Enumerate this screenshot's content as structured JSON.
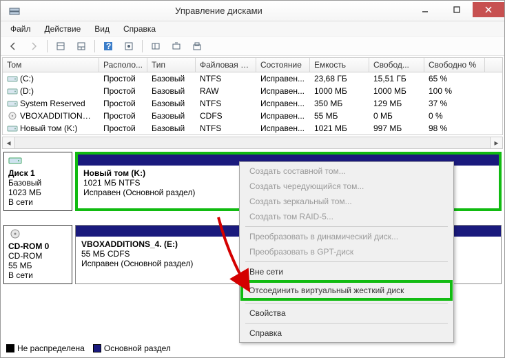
{
  "window": {
    "title": "Управление дисками"
  },
  "menu": {
    "file": "Файл",
    "action": "Действие",
    "view": "Вид",
    "help": "Справка"
  },
  "columns": {
    "volume": "Том",
    "layout": "Располо...",
    "type": "Тип",
    "fs": "Файловая с...",
    "status": "Состояние",
    "capacity": "Емкость",
    "free": "Свобод...",
    "freepct": "Свободно %"
  },
  "volumes": [
    {
      "name": "(C:)",
      "layout": "Простой",
      "type": "Базовый",
      "fs": "NTFS",
      "status": "Исправен...",
      "capacity": "23,68 ГБ",
      "free": "15,51 ГБ",
      "pct": "65 %",
      "kind": "hdd"
    },
    {
      "name": "(D:)",
      "layout": "Простой",
      "type": "Базовый",
      "fs": "RAW",
      "status": "Исправен...",
      "capacity": "1000 МБ",
      "free": "1000 МБ",
      "pct": "100 %",
      "kind": "hdd"
    },
    {
      "name": "System Reserved",
      "layout": "Простой",
      "type": "Базовый",
      "fs": "NTFS",
      "status": "Исправен...",
      "capacity": "350 МБ",
      "free": "129 МБ",
      "pct": "37 %",
      "kind": "hdd"
    },
    {
      "name": "VBOXADDITIONS_...",
      "layout": "Простой",
      "type": "Базовый",
      "fs": "CDFS",
      "status": "Исправен...",
      "capacity": "55 МБ",
      "free": "0 МБ",
      "pct": "0 %",
      "kind": "cd"
    },
    {
      "name": "Новый том (K:)",
      "layout": "Простой",
      "type": "Базовый",
      "fs": "NTFS",
      "status": "Исправен...",
      "capacity": "1021 МБ",
      "free": "997 МБ",
      "pct": "98 %",
      "kind": "hdd"
    }
  ],
  "disk1": {
    "title": "Диск 1",
    "type": "Базовый",
    "size": "1023 МБ",
    "status": "В сети"
  },
  "vol1": {
    "title": "Новый том  (K:)",
    "line2": "1021 МБ NTFS",
    "line3": "Исправен (Основной раздел)"
  },
  "cd0": {
    "title": "CD-ROM 0",
    "type": "CD-ROM",
    "size": "55 МБ",
    "status": "В сети"
  },
  "vol2": {
    "title": "VBOXADDITIONS_4.  (E:)",
    "line2": "55 МБ CDFS",
    "line3": "Исправен (Основной раздел)"
  },
  "legend": {
    "unalloc": "Не распределена",
    "primary": "Основной раздел"
  },
  "ctx": {
    "spanned": "Создать составной том...",
    "striped": "Создать чередующийся том...",
    "mirrored": "Создать зеркальный том...",
    "raid5": "Создать том RAID-5...",
    "todyn": "Преобразовать в динамический диск...",
    "togpt": "Преобразовать в GPT-диск",
    "offline": "Вне сети",
    "detach": "Отсоединить виртуальный жесткий диск",
    "props": "Свойства",
    "help": "Справка"
  }
}
